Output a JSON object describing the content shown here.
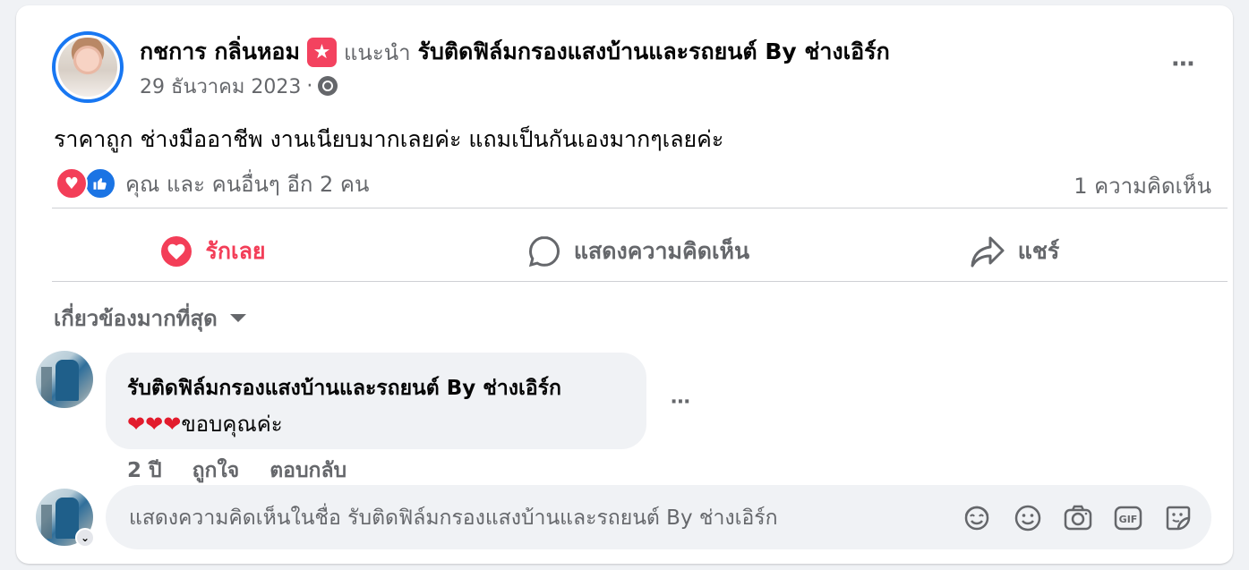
{
  "post": {
    "author": "กชการ กลิ่นหอม",
    "recommend_label": "แนะนำ",
    "page_name": "รับติดฟิล์มกรองแสงบ้านและรถยนต์ By ช่างเอิร์ก",
    "date": "29 ธันวาคม 2023",
    "separator": "·",
    "text": "ราคาถูก ช่างมืออาชีพ งานเนียบมากเลยค่ะ แถมเป็นกันเองมากๆเลยค่ะ",
    "reactions_text": "คุณ และ คนอื่นๆ อีก 2 คน",
    "comments_count": "1 ความคิดเห็น",
    "more_icon": "⋯"
  },
  "actions": {
    "love_label": "รักเลย",
    "comment_label": "แสดงความคิดเห็น",
    "share_label": "แชร์"
  },
  "comments": {
    "sort_label": "เกี่ยวข้องมากที่สุด",
    "items": [
      {
        "name": "รับติดฟิล์มกรองแสงบ้านและรถยนต์ By ช่างเอิร์ก",
        "hearts": "❤❤❤",
        "text": "ขอบคุณค่ะ",
        "time": "2 ปี",
        "like_label": "ถูกใจ",
        "reply_label": "ตอบกลับ",
        "more_icon": "⋯"
      }
    ]
  },
  "composer": {
    "placeholder": "แสดงความคิดเห็นในชื่อ รับติดฟิล์มกรองแสงบ้านและรถยนต์ By ช่างเอิร์ก",
    "gif_label": "GIF"
  },
  "colors": {
    "accent_blue": "#1877f2",
    "love_red": "#f33e58",
    "secondary_text": "#65676b",
    "bubble_bg": "#f0f2f5"
  }
}
